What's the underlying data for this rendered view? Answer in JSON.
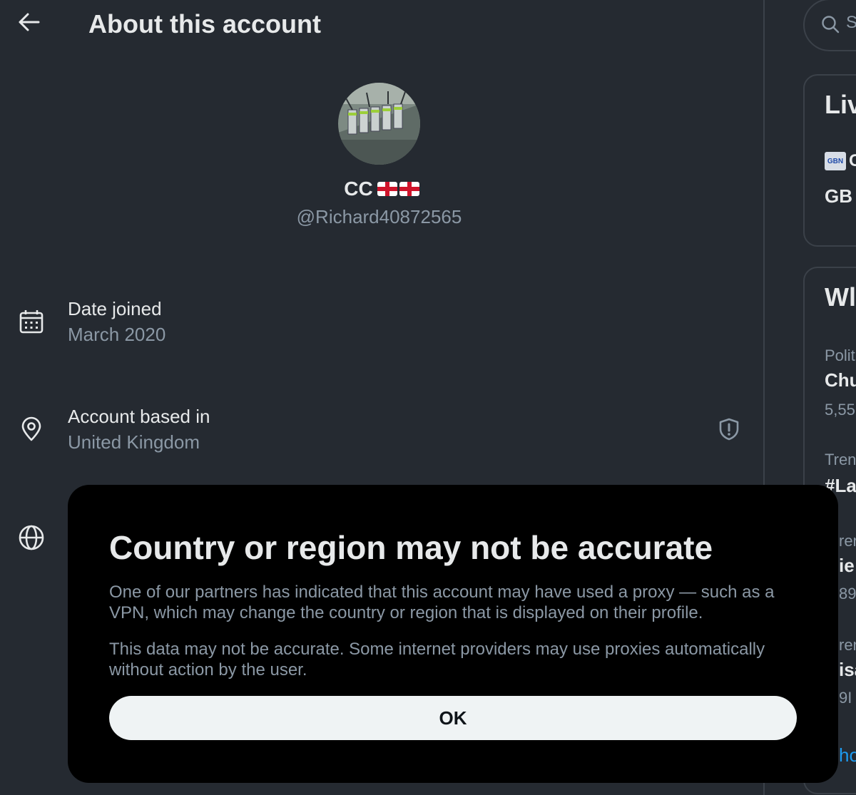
{
  "header": {
    "title": "About this account"
  },
  "profile": {
    "display_name": "CC",
    "flags": "England flag, England flag",
    "handle": "@Richard40872565"
  },
  "details": {
    "date_joined_label": "Date joined",
    "date_joined_value": "March 2020",
    "based_in_label": "Account based in",
    "based_in_value": "United Kingdom"
  },
  "sidebar": {
    "search_partial": "S",
    "live_title_partial": "Liv",
    "live_source_partial": "C",
    "live_source_logo": "GBN",
    "live_text_partial": "GB",
    "trends_title_partial": "Wl",
    "trend_items": [
      {
        "category": "Polit",
        "name": "Chu",
        "count": "5,55"
      },
      {
        "category": "Tren",
        "name": "#La",
        "count": ""
      },
      {
        "category": "ren",
        "name": "ie",
        "count": "89"
      },
      {
        "category": "ren",
        "name": "isa",
        "count": "9I"
      }
    ],
    "show_more_partial": "ho"
  },
  "modal": {
    "title": "Country or region may not be accurate",
    "paragraph1": "One of our partners has indicated that this account may have used a proxy — such as a VPN, which may change the country or region that is displayed on their profile.",
    "paragraph2": "This data may not be accurate. Some internet providers may use proxies automatically without action by the user.",
    "ok_label": "OK"
  },
  "colors": {
    "background": "#252a31",
    "modal_background": "#000000",
    "primary_text": "#e7e9ea",
    "secondary_text": "#8b98a5",
    "button_background": "#eff3f4",
    "link_blue": "#1d9bf0"
  }
}
